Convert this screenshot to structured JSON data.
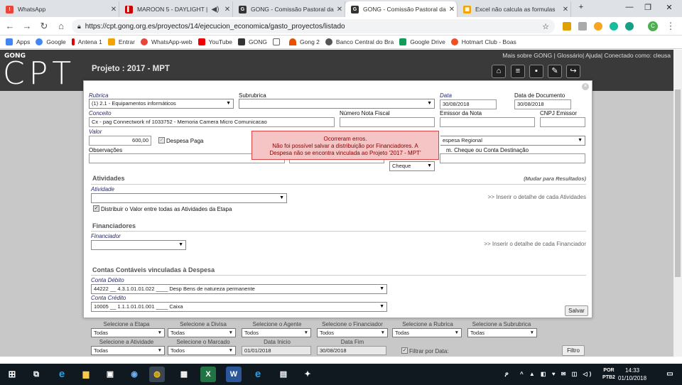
{
  "browser": {
    "tabs": [
      {
        "title": "WhatsApp",
        "color": "#e8453c"
      },
      {
        "title": "MAROON 5 - DAYLIGHT |",
        "color": "#cc0000"
      },
      {
        "title": "GONG - Comissão Pastoral da",
        "color": "#333333"
      },
      {
        "title": "GONG - Comissão Pastoral da",
        "color": "#333333"
      },
      {
        "title": "Excel não calcula as formulas",
        "color": "#f4a400"
      }
    ],
    "url": "https://cpt.gong.org.es/proyectos/14/ejecucion_economica/gasto_proyectos/listado",
    "bookmarks": [
      "Apps",
      "Google",
      "Antena 1",
      "Entrar",
      "WhatsApp-web",
      "YouTube",
      "GONG",
      "",
      "Gong 2",
      "Banco Central do Bra",
      "Google Drive",
      "Hotmart Club - Boas"
    ]
  },
  "site": {
    "logo_small": "GONG",
    "logo_big": "CPT",
    "project_title": "Projeto : 2017 - MPT",
    "top_links": "Mais sobre GONG | Glossário| Ajuda| Conectado como: cleusa"
  },
  "form": {
    "rubrica_label": "Rubrica",
    "rubrica_value": "(1) 2.1 - Equipamentos informáticos",
    "subrubrica_label": "Subrubrica",
    "subrubrica_value": "",
    "data_label": "Data",
    "data_value": "30/08/2018",
    "data_doc_label": "Data de Documento",
    "data_doc_value": "30/08/2018",
    "conceito_label": "Conceito",
    "conceito_value": "Cx - pag Connectwork nf 1033752 - Memoria Camera Micro Comunicacao",
    "nota_label": "Número Nota Fiscal",
    "nota_value": "",
    "emissor_label": "Emissor da Nota",
    "emissor_value": "",
    "cnpj_label": "CNPJ Emissor",
    "cnpj_value": "",
    "valor_label": "Valor",
    "valor_value": "600,00",
    "paga_label": "Despesa Paga",
    "pais_value": "espesa Regional",
    "obs_label": "Observações",
    "cheque_label": "m. Cheque ou Conta Destinação",
    "forma_value": "Cheque",
    "atividades_title": "Atividades",
    "mudar": "(Mudar para Resultados)",
    "atividade_label": "Atividade",
    "inserir_atividades": ">> Inserir o detalhe de cada Atividades",
    "distribuir_label": "Distribuir o Valor entre todas as Atividades da Etapa",
    "financiadores_title": "Financiadores",
    "financiador_label": "Financiador",
    "inserir_financiador": ">> Inserir o detalhe de cada Financiador",
    "contas_title": "Contas Contáveis vinculadas à Despesa",
    "debito_label": "Conta Débito",
    "debito_value": "44222 __ 4.3.1.01.01.022 ____ Desp Bens de natureza permanente",
    "credito_label": "Conta Crédito",
    "credito_value": "10005 __ 1.1.1.01.01.001 ____ Caixa",
    "salvar": "Salvar"
  },
  "error": {
    "line1": "Ocorreram erros.",
    "line2": "Não foi possível salvar a distribuição por Financiadores. A",
    "line3": "Despesa não se encontra vinculada ao Projeto '2017 - MPT'"
  },
  "filters": {
    "row1": [
      {
        "label": "Selecione a Etapa",
        "value": "Todas"
      },
      {
        "label": "Selecione a Divisa",
        "value": "Todas"
      },
      {
        "label": "Selecione o Agente",
        "value": "Todos"
      },
      {
        "label": "Selecione o Financiador",
        "value": "Todos"
      },
      {
        "label": "Selecione a Rubrica",
        "value": "Todas"
      },
      {
        "label": "Selecione a Subrubrica",
        "value": "Todas"
      }
    ],
    "row2": [
      {
        "label": "Selecione a Atividade",
        "value": "Todas"
      },
      {
        "label": "Selecione o Marcado",
        "value": "Todos"
      },
      {
        "label": "Data Inicio",
        "value": "01/01/2018"
      },
      {
        "label": "Data Fim",
        "value": "30/08/2018"
      }
    ],
    "filtrar_label": "Filtrar por Data:",
    "filtro_button": "Filtro"
  },
  "taskbar": {
    "lang1": "POR",
    "lang2": "PTB2",
    "time": "14:33",
    "date": "01/10/2018"
  }
}
